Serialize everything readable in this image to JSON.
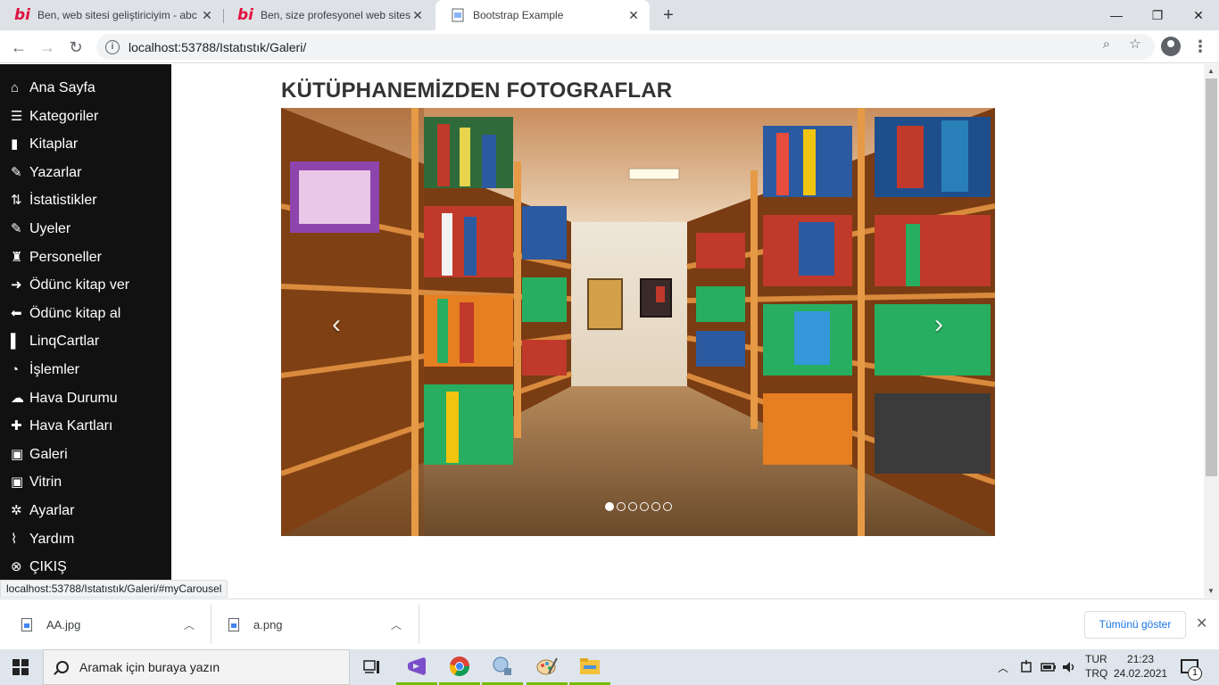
{
  "browser": {
    "tabs": [
      {
        "title": "Ben, web sitesi geliştiriciyim - abc",
        "favicon": "bi"
      },
      {
        "title": "Ben, size profesyonel web sitesi h",
        "favicon": "bi"
      },
      {
        "title": "Bootstrap Example",
        "favicon": "page"
      }
    ],
    "url": "localhost:53788/Istatıstık/Galeri/",
    "status_url": "localhost:53788/Istatıstık/Galeri/#myCarousel"
  },
  "sidebar": {
    "items": [
      {
        "label": "Ana Sayfa",
        "icon": "home-icon"
      },
      {
        "label": "Kategoriler",
        "icon": "list-icon"
      },
      {
        "label": "Kitaplar",
        "icon": "book-icon"
      },
      {
        "label": "Yazarlar",
        "icon": "pencil-icon"
      },
      {
        "label": "İstatistikler",
        "icon": "sort-icon"
      },
      {
        "label": "Uyeler",
        "icon": "pencil-icon"
      },
      {
        "label": "Personeller",
        "icon": "tower-icon"
      },
      {
        "label": "Ödünc kitap ver",
        "icon": "arrow-right-icon"
      },
      {
        "label": "Ödünc kitap al",
        "icon": "arrow-left-icon"
      },
      {
        "label": "LinqCartlar",
        "icon": "bookmark-icon"
      },
      {
        "label": "İşlemler",
        "icon": "dashboard-icon"
      },
      {
        "label": "Hava Durumu",
        "icon": "cloud-icon"
      },
      {
        "label": "Hava Kartları",
        "icon": "plus-icon"
      },
      {
        "label": "Galeri",
        "icon": "picture-icon"
      },
      {
        "label": "Vitrin",
        "icon": "picture-icon"
      },
      {
        "label": "Ayarlar",
        "icon": "cog-icon"
      },
      {
        "label": "Yardım",
        "icon": "paperclip-icon"
      },
      {
        "label": "ÇIKIŞ",
        "icon": "remove-circle-icon"
      }
    ]
  },
  "main": {
    "heading": "KÜTÜPHANEMİZDEN FOTOGRAFLAR",
    "carousel": {
      "slide_count": 6,
      "active_slide": 1
    }
  },
  "downloads": {
    "items": [
      {
        "name": "AA.jpg"
      },
      {
        "name": "a.png"
      }
    ],
    "show_all": "Tümünü göster"
  },
  "taskbar": {
    "search_placeholder": "Aramak için buraya yazın",
    "lang_top": "TUR",
    "lang_bottom": "TRQ",
    "time": "21:23",
    "date": "24.02.2021",
    "notification_count": "1"
  }
}
